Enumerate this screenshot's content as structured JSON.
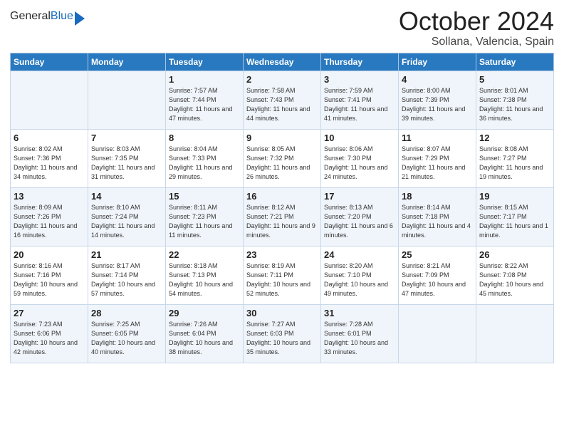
{
  "header": {
    "logo_general": "General",
    "logo_blue": "Blue",
    "month": "October 2024",
    "location": "Sollana, Valencia, Spain"
  },
  "weekdays": [
    "Sunday",
    "Monday",
    "Tuesday",
    "Wednesday",
    "Thursday",
    "Friday",
    "Saturday"
  ],
  "weeks": [
    [
      {
        "day": "",
        "sunrise": "",
        "sunset": "",
        "daylight": ""
      },
      {
        "day": "",
        "sunrise": "",
        "sunset": "",
        "daylight": ""
      },
      {
        "day": "1",
        "sunrise": "Sunrise: 7:57 AM",
        "sunset": "Sunset: 7:44 PM",
        "daylight": "Daylight: 11 hours and 47 minutes."
      },
      {
        "day": "2",
        "sunrise": "Sunrise: 7:58 AM",
        "sunset": "Sunset: 7:43 PM",
        "daylight": "Daylight: 11 hours and 44 minutes."
      },
      {
        "day": "3",
        "sunrise": "Sunrise: 7:59 AM",
        "sunset": "Sunset: 7:41 PM",
        "daylight": "Daylight: 11 hours and 41 minutes."
      },
      {
        "day": "4",
        "sunrise": "Sunrise: 8:00 AM",
        "sunset": "Sunset: 7:39 PM",
        "daylight": "Daylight: 11 hours and 39 minutes."
      },
      {
        "day": "5",
        "sunrise": "Sunrise: 8:01 AM",
        "sunset": "Sunset: 7:38 PM",
        "daylight": "Daylight: 11 hours and 36 minutes."
      }
    ],
    [
      {
        "day": "6",
        "sunrise": "Sunrise: 8:02 AM",
        "sunset": "Sunset: 7:36 PM",
        "daylight": "Daylight: 11 hours and 34 minutes."
      },
      {
        "day": "7",
        "sunrise": "Sunrise: 8:03 AM",
        "sunset": "Sunset: 7:35 PM",
        "daylight": "Daylight: 11 hours and 31 minutes."
      },
      {
        "day": "8",
        "sunrise": "Sunrise: 8:04 AM",
        "sunset": "Sunset: 7:33 PM",
        "daylight": "Daylight: 11 hours and 29 minutes."
      },
      {
        "day": "9",
        "sunrise": "Sunrise: 8:05 AM",
        "sunset": "Sunset: 7:32 PM",
        "daylight": "Daylight: 11 hours and 26 minutes."
      },
      {
        "day": "10",
        "sunrise": "Sunrise: 8:06 AM",
        "sunset": "Sunset: 7:30 PM",
        "daylight": "Daylight: 11 hours and 24 minutes."
      },
      {
        "day": "11",
        "sunrise": "Sunrise: 8:07 AM",
        "sunset": "Sunset: 7:29 PM",
        "daylight": "Daylight: 11 hours and 21 minutes."
      },
      {
        "day": "12",
        "sunrise": "Sunrise: 8:08 AM",
        "sunset": "Sunset: 7:27 PM",
        "daylight": "Daylight: 11 hours and 19 minutes."
      }
    ],
    [
      {
        "day": "13",
        "sunrise": "Sunrise: 8:09 AM",
        "sunset": "Sunset: 7:26 PM",
        "daylight": "Daylight: 11 hours and 16 minutes."
      },
      {
        "day": "14",
        "sunrise": "Sunrise: 8:10 AM",
        "sunset": "Sunset: 7:24 PM",
        "daylight": "Daylight: 11 hours and 14 minutes."
      },
      {
        "day": "15",
        "sunrise": "Sunrise: 8:11 AM",
        "sunset": "Sunset: 7:23 PM",
        "daylight": "Daylight: 11 hours and 11 minutes."
      },
      {
        "day": "16",
        "sunrise": "Sunrise: 8:12 AM",
        "sunset": "Sunset: 7:21 PM",
        "daylight": "Daylight: 11 hours and 9 minutes."
      },
      {
        "day": "17",
        "sunrise": "Sunrise: 8:13 AM",
        "sunset": "Sunset: 7:20 PM",
        "daylight": "Daylight: 11 hours and 6 minutes."
      },
      {
        "day": "18",
        "sunrise": "Sunrise: 8:14 AM",
        "sunset": "Sunset: 7:18 PM",
        "daylight": "Daylight: 11 hours and 4 minutes."
      },
      {
        "day": "19",
        "sunrise": "Sunrise: 8:15 AM",
        "sunset": "Sunset: 7:17 PM",
        "daylight": "Daylight: 11 hours and 1 minute."
      }
    ],
    [
      {
        "day": "20",
        "sunrise": "Sunrise: 8:16 AM",
        "sunset": "Sunset: 7:16 PM",
        "daylight": "Daylight: 10 hours and 59 minutes."
      },
      {
        "day": "21",
        "sunrise": "Sunrise: 8:17 AM",
        "sunset": "Sunset: 7:14 PM",
        "daylight": "Daylight: 10 hours and 57 minutes."
      },
      {
        "day": "22",
        "sunrise": "Sunrise: 8:18 AM",
        "sunset": "Sunset: 7:13 PM",
        "daylight": "Daylight: 10 hours and 54 minutes."
      },
      {
        "day": "23",
        "sunrise": "Sunrise: 8:19 AM",
        "sunset": "Sunset: 7:11 PM",
        "daylight": "Daylight: 10 hours and 52 minutes."
      },
      {
        "day": "24",
        "sunrise": "Sunrise: 8:20 AM",
        "sunset": "Sunset: 7:10 PM",
        "daylight": "Daylight: 10 hours and 49 minutes."
      },
      {
        "day": "25",
        "sunrise": "Sunrise: 8:21 AM",
        "sunset": "Sunset: 7:09 PM",
        "daylight": "Daylight: 10 hours and 47 minutes."
      },
      {
        "day": "26",
        "sunrise": "Sunrise: 8:22 AM",
        "sunset": "Sunset: 7:08 PM",
        "daylight": "Daylight: 10 hours and 45 minutes."
      }
    ],
    [
      {
        "day": "27",
        "sunrise": "Sunrise: 7:23 AM",
        "sunset": "Sunset: 6:06 PM",
        "daylight": "Daylight: 10 hours and 42 minutes."
      },
      {
        "day": "28",
        "sunrise": "Sunrise: 7:25 AM",
        "sunset": "Sunset: 6:05 PM",
        "daylight": "Daylight: 10 hours and 40 minutes."
      },
      {
        "day": "29",
        "sunrise": "Sunrise: 7:26 AM",
        "sunset": "Sunset: 6:04 PM",
        "daylight": "Daylight: 10 hours and 38 minutes."
      },
      {
        "day": "30",
        "sunrise": "Sunrise: 7:27 AM",
        "sunset": "Sunset: 6:03 PM",
        "daylight": "Daylight: 10 hours and 35 minutes."
      },
      {
        "day": "31",
        "sunrise": "Sunrise: 7:28 AM",
        "sunset": "Sunset: 6:01 PM",
        "daylight": "Daylight: 10 hours and 33 minutes."
      },
      {
        "day": "",
        "sunrise": "",
        "sunset": "",
        "daylight": ""
      },
      {
        "day": "",
        "sunrise": "",
        "sunset": "",
        "daylight": ""
      }
    ]
  ]
}
